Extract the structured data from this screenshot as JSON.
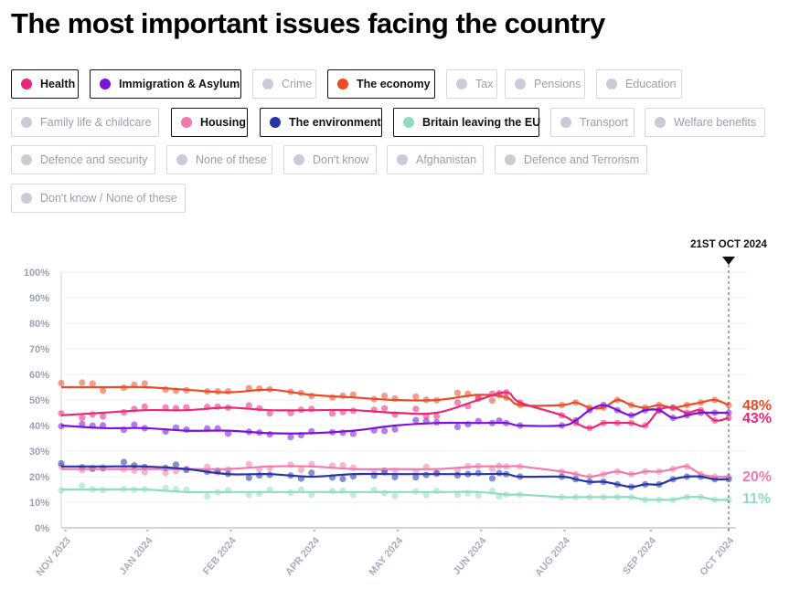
{
  "title": "The most important issues facing the country",
  "filters": [
    {
      "label": "Health",
      "active": true,
      "color": "#e8267a"
    },
    {
      "label": "Immigration & Asylum",
      "active": true,
      "color": "#7a12d8"
    },
    {
      "label": "Crime",
      "active": false,
      "color": "#c9ccd6"
    },
    {
      "label": "The economy",
      "active": true,
      "color": "#ea4a25"
    },
    {
      "label": "Tax",
      "active": false,
      "color": "#c9ccd6"
    },
    {
      "label": "Pensions",
      "active": false,
      "color": "#c9ccd6"
    },
    {
      "label": "Education",
      "active": false,
      "color": "#c9ccd6"
    },
    {
      "label": "Family life & childcare",
      "active": false,
      "color": "#c9ccd6"
    },
    {
      "label": "Housing",
      "active": true,
      "color": "#f07ab0"
    },
    {
      "label": "The environment",
      "active": true,
      "color": "#2535a8"
    },
    {
      "label": "Britain leaving the EU",
      "active": true,
      "color": "#8fdcc3"
    },
    {
      "label": "Transport",
      "active": false,
      "color": "#c9ccd6"
    },
    {
      "label": "Welfare benefits",
      "active": false,
      "color": "#c9ccd6"
    },
    {
      "label": "Defence and security",
      "active": false,
      "color": "#c9ccd6"
    },
    {
      "label": "None of these",
      "active": false,
      "color": "#c9ccd6"
    },
    {
      "label": "Don't know",
      "active": false,
      "color": "#c9ccd6"
    },
    {
      "label": "Afghanistan",
      "active": false,
      "color": "#c9ccd6"
    },
    {
      "label": "Defence and Terrorism",
      "active": false,
      "color": "#c9ccd6"
    },
    {
      "label": "Don't know / None of these",
      "active": false,
      "color": "#c9ccd6"
    }
  ],
  "chart_data": {
    "type": "line",
    "title": "The most important issues facing the country",
    "xlabel": "",
    "ylabel": "",
    "ylim": [
      0,
      100
    ],
    "yticks": [
      "0%",
      "10%",
      "20%",
      "30%",
      "40%",
      "50%",
      "60%",
      "70%",
      "80%",
      "90%",
      "100%"
    ],
    "xticks": [
      "NOV 2023",
      "JAN 2024",
      "FEB 2024",
      "APR 2024",
      "MAY 2024",
      "JUN 2024",
      "AUG 2024",
      "SEP 2024",
      "OCT 2024"
    ],
    "x_range": [
      0,
      48
    ],
    "xtick_positions": [
      0.3,
      6.2,
      12.2,
      18.2,
      24.2,
      30.2,
      36.2,
      42.4,
      48
    ],
    "current_date_label": "21ST OCT 2024",
    "grid": true,
    "series": [
      {
        "name": "The economy",
        "color": "#ea4a25",
        "end_label": "48%",
        "x": [
          0,
          3,
          6,
          9,
          12,
          15,
          18,
          21,
          24,
          27,
          30,
          32,
          33,
          36,
          37,
          38,
          39,
          40,
          41,
          42,
          43,
          44,
          45,
          46,
          47,
          48
        ],
        "values": [
          55,
          55,
          55,
          54,
          53,
          54,
          52,
          51,
          50,
          50,
          52,
          51,
          48,
          48,
          49,
          47,
          47,
          50,
          48,
          47,
          48,
          47,
          48,
          49,
          50,
          48
        ]
      },
      {
        "name": "Health",
        "color": "#e8267a",
        "end_label": "43%",
        "x": [
          0,
          3,
          6,
          9,
          12,
          15,
          18,
          21,
          24,
          27,
          30,
          32,
          33,
          36,
          37,
          38,
          39,
          40,
          41,
          42,
          43,
          44,
          45,
          46,
          47,
          48
        ],
        "values": [
          44,
          45,
          46,
          46,
          47,
          46,
          46,
          46,
          45,
          45,
          50,
          53,
          49,
          44,
          41,
          39,
          41,
          41,
          41,
          40,
          46,
          47,
          45,
          46,
          42,
          43
        ]
      },
      {
        "name": "Immigration & Asylum",
        "color": "#7a12d8",
        "end_label": "",
        "x": [
          0,
          3,
          6,
          9,
          12,
          15,
          18,
          21,
          24,
          27,
          30,
          32,
          33,
          36,
          37,
          38,
          39,
          40,
          41,
          42,
          43,
          44,
          45,
          46,
          47,
          48
        ],
        "values": [
          40,
          39,
          39,
          38,
          38,
          37,
          37,
          38,
          40,
          41,
          41,
          41,
          40,
          40,
          42,
          46,
          48,
          46,
          44,
          46,
          46,
          43,
          44,
          45,
          45,
          45
        ]
      },
      {
        "name": "Housing",
        "color": "#f07ab0",
        "end_label": "20%",
        "x": [
          0,
          3,
          6,
          9,
          12,
          15,
          18,
          21,
          24,
          27,
          30,
          32,
          33,
          36,
          37,
          38,
          39,
          40,
          41,
          42,
          43,
          44,
          45,
          46,
          47,
          48
        ],
        "values": [
          23,
          23,
          23,
          23,
          23,
          24,
          24,
          23,
          23,
          23,
          24,
          24,
          24,
          22,
          21,
          20,
          21,
          22,
          21,
          22,
          22,
          23,
          24,
          21,
          20,
          20
        ]
      },
      {
        "name": "The environment",
        "color": "#2535a8",
        "end_label": "",
        "x": [
          0,
          3,
          6,
          9,
          12,
          15,
          18,
          21,
          24,
          27,
          30,
          32,
          33,
          36,
          37,
          38,
          39,
          40,
          41,
          42,
          43,
          44,
          45,
          46,
          47,
          48
        ],
        "values": [
          24,
          24,
          24,
          23,
          21,
          21,
          20,
          21,
          21,
          21,
          21,
          21,
          20,
          20,
          19,
          18,
          18,
          17,
          16,
          17,
          17,
          19,
          20,
          20,
          19,
          19
        ]
      },
      {
        "name": "Britain leaving the EU",
        "color": "#8fdcc3",
        "end_label": "11%",
        "x": [
          0,
          3,
          6,
          9,
          12,
          15,
          18,
          21,
          24,
          27,
          30,
          32,
          33,
          36,
          37,
          38,
          39,
          40,
          41,
          42,
          43,
          44,
          45,
          46,
          47,
          48
        ],
        "values": [
          15,
          15,
          15,
          14,
          14,
          14,
          14,
          14,
          14,
          14,
          14,
          13,
          13,
          12,
          12,
          12,
          12,
          12,
          12,
          11,
          11,
          11,
          12,
          12,
          11,
          11
        ]
      }
    ]
  }
}
